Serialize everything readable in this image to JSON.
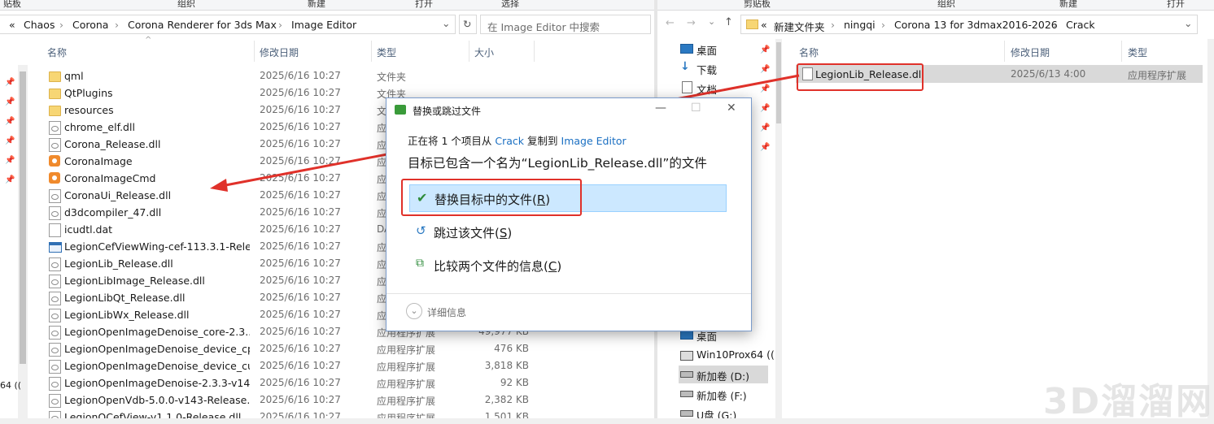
{
  "left": {
    "ribbon": [
      "贴板",
      "组织",
      "新建",
      "打开",
      "选择"
    ],
    "breadcrumb_prefix": "«",
    "breadcrumb": [
      "Chaos",
      "Corona",
      "Corona Renderer for 3ds Max",
      "Image Editor"
    ],
    "search_placeholder": "在 Image Editor 中搜索",
    "columns": {
      "name": "名称",
      "date": "修改日期",
      "type": "类型",
      "size": "大小"
    },
    "rows": [
      {
        "name": "qml",
        "date": "2025/6/16 10:27",
        "type": "文件夹",
        "size": "",
        "icon": "folder"
      },
      {
        "name": "QtPlugins",
        "date": "2025/6/16 10:27",
        "type": "文件夹",
        "size": "",
        "icon": "folder"
      },
      {
        "name": "resources",
        "date": "2025/6/16 10:27",
        "type": "文",
        "size": "",
        "icon": "folder"
      },
      {
        "name": "chrome_elf.dll",
        "date": "2025/6/16 10:27",
        "type": "应",
        "size": "",
        "icon": "dll"
      },
      {
        "name": "Corona_Release.dll",
        "date": "2025/6/16 10:27",
        "type": "应",
        "size": "",
        "icon": "dll"
      },
      {
        "name": "CoronaImage",
        "date": "2025/6/16 10:27",
        "type": "应",
        "size": "",
        "icon": "exe"
      },
      {
        "name": "CoronaImageCmd",
        "date": "2025/6/16 10:27",
        "type": "应",
        "size": "",
        "icon": "exe"
      },
      {
        "name": "CoronaUi_Release.dll",
        "date": "2025/6/16 10:27",
        "type": "应",
        "size": "",
        "icon": "dll"
      },
      {
        "name": "d3dcompiler_47.dll",
        "date": "2025/6/16 10:27",
        "type": "应",
        "size": "",
        "icon": "dll"
      },
      {
        "name": "icudtl.dat",
        "date": "2025/6/16 10:27",
        "type": "DA",
        "size": "",
        "icon": "dat"
      },
      {
        "name": "LegionCefViewWing-cef-113.3.1-Rele...",
        "date": "2025/6/16 10:27",
        "type": "应",
        "size": "",
        "icon": "app"
      },
      {
        "name": "LegionLib_Release.dll",
        "date": "2025/6/16 10:27",
        "type": "应",
        "size": "",
        "icon": "dll"
      },
      {
        "name": "LegionLibImage_Release.dll",
        "date": "2025/6/16 10:27",
        "type": "应",
        "size": "",
        "icon": "dll"
      },
      {
        "name": "LegionLibQt_Release.dll",
        "date": "2025/6/16 10:27",
        "type": "应",
        "size": "",
        "icon": "dll"
      },
      {
        "name": "LegionLibWx_Release.dll",
        "date": "2025/6/16 10:27",
        "type": "应",
        "size": "",
        "icon": "dll"
      },
      {
        "name": "LegionOpenImageDenoise_core-2.3....",
        "date": "2025/6/16 10:27",
        "type": "应用程序扩展",
        "size": "49,977 KB",
        "icon": "dll"
      },
      {
        "name": "LegionOpenImageDenoise_device_cp...",
        "date": "2025/6/16 10:27",
        "type": "应用程序扩展",
        "size": "476 KB",
        "icon": "dll"
      },
      {
        "name": "LegionOpenImageDenoise_device_cu...",
        "date": "2025/6/16 10:27",
        "type": "应用程序扩展",
        "size": "3,818 KB",
        "icon": "dll"
      },
      {
        "name": "LegionOpenImageDenoise-2.3.3-v14...",
        "date": "2025/6/16 10:27",
        "type": "应用程序扩展",
        "size": "92 KB",
        "icon": "dll"
      },
      {
        "name": "LegionOpenVdb-5.0.0-v143-Release.dll",
        "date": "2025/6/16 10:27",
        "type": "应用程序扩展",
        "size": "2,382 KB",
        "icon": "dll"
      },
      {
        "name": "LegionQCefView-v1.1.0-Release.dll",
        "date": "2025/6/16 10:27",
        "type": "应用程序扩展",
        "size": "1,501 KB",
        "icon": "dll"
      }
    ],
    "nav_fragment": "64 (("
  },
  "right": {
    "ribbon": [
      "剪贴板",
      "组织",
      "新建",
      "打开"
    ],
    "breadcrumb_prefix": "«",
    "breadcrumb": [
      "新建文件夹",
      "ningqi",
      "Corona 13 for 3dmax2016-2026",
      "Crack"
    ],
    "columns": {
      "name": "名称",
      "date": "修改日期",
      "type": "类型"
    },
    "file": {
      "name": "LegionLib_Release.dll",
      "date": "2025/6/13 4:00",
      "type": "应用程序扩展"
    },
    "nav_top": [
      "桌面",
      "下载",
      "文档"
    ],
    "nav_bottom": [
      "桌面",
      "Win10Prox64 ((",
      "新加卷 (D:)",
      "新加卷 (F:)",
      "U盘 (G:)"
    ]
  },
  "dialog": {
    "title": "替换或跳过文件",
    "progress_prefix": "正在将 1 个项目从",
    "source": "Crack",
    "copy_to": "复制到",
    "destination": "Image Editor",
    "heading": "目标已包含一个名为“LegionLib_Release.dll”的文件",
    "option_replace": "替换目标中的文件(",
    "option_replace_key": "R",
    "option_skip": "跳过该文件(",
    "option_skip_key": "S",
    "option_compare": "比较两个文件的信息(",
    "option_compare_key": "C",
    "close_paren": ")",
    "details": "详细信息"
  },
  "watermark": "3D溜溜网",
  "colors": {
    "accent": "#1a6fc2",
    "annotation_red": "#e0312a",
    "selection": "#cce8ff"
  }
}
